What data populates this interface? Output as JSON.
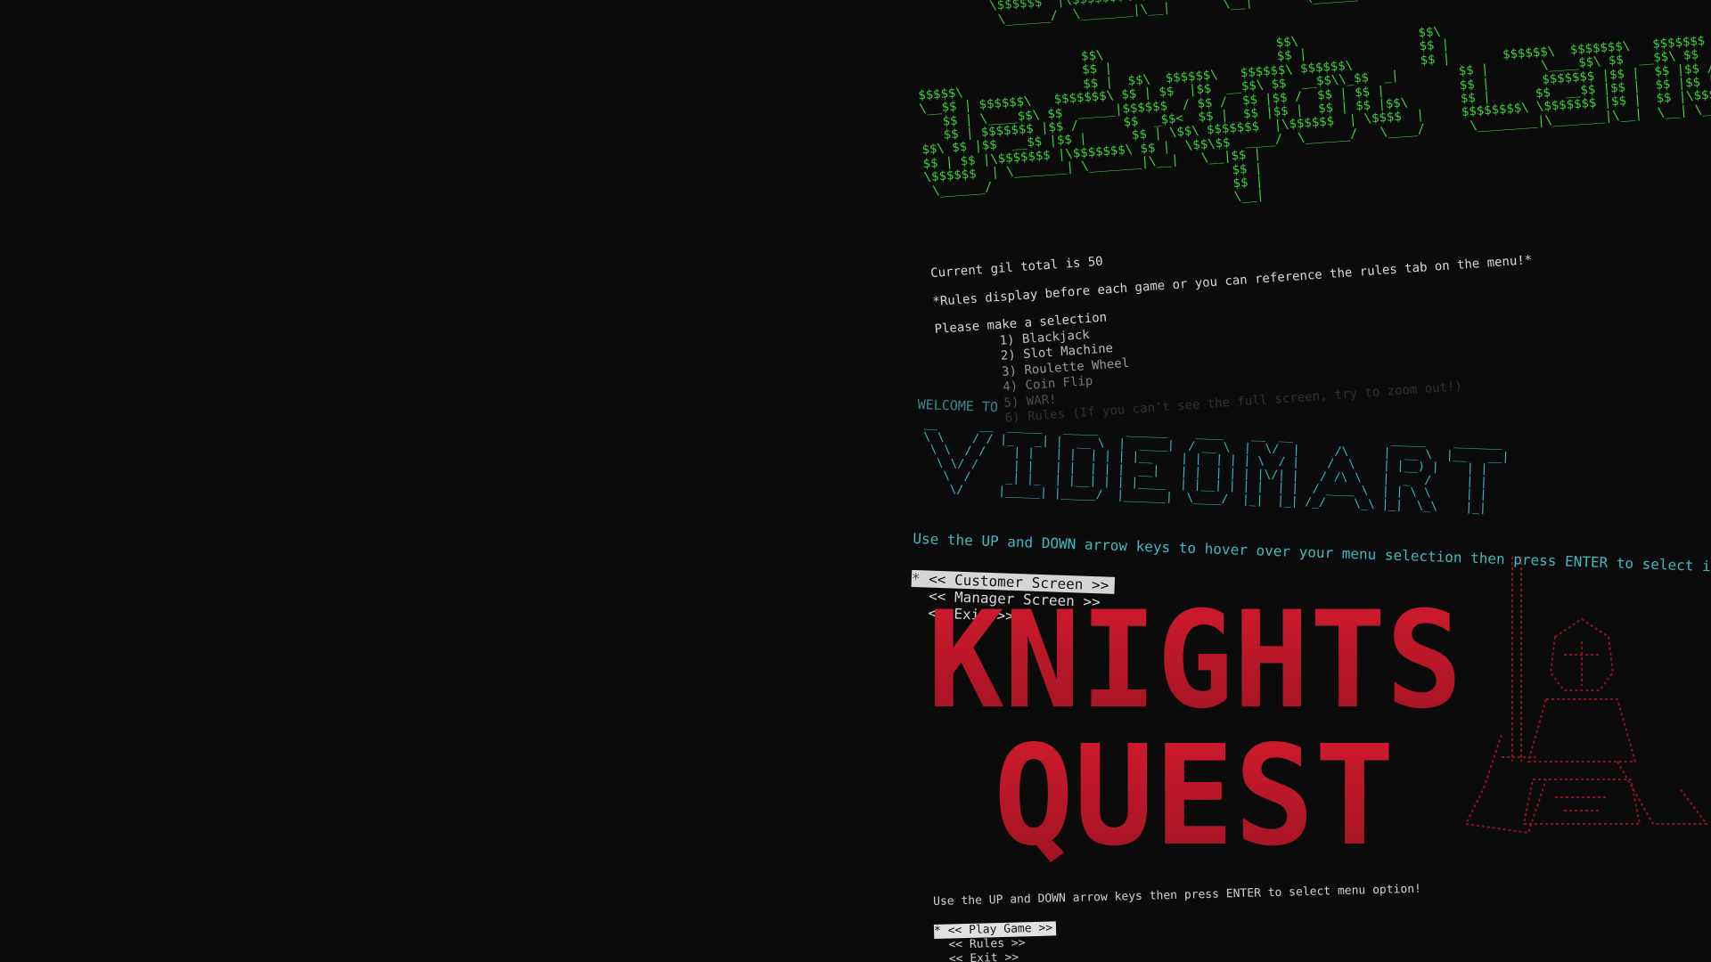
{
  "jackpot": {
    "title_ascii_top": "      $$ |$$  __$$\\ $$$$$$  |   $$  _|     $$  ____$\\   $$$$$$  |  $$$$$$  |\n  $$\\   $$ |$$$$$$$$ |$$  _|     $$ |      $$$$$$$ |   \\$$$$$$  |\\$$$$$$  |\n  $$ |  $$ |$$   ____|$$ |       $$ |      $$  __$$<     \\____$$\\ \\____$$\\\n  \\$$$$$$  |\\$$$$$$$\\ $$ |       $$ |      \\$$$$$$  |   $$$$$$  |\\$$$$$$  |\n   \\______/  \\_______|\\__|       \\__|       \\______/    \\______/  \\______/",
    "title_ascii_main": "                      $$\\                       $$\\                $$\\\n                      $$ |                      $$ |               $$ |\n$$$$$\\                $$ |  $$\\  $$$$$$\\   $$$$$$\\ $$$$$$\\         $$ |       $$$$$$\\  $$$$$$$\\   $$$$$$$ |\n\\__$$ | $$$$$$\\   $$$$$$$\\ $$ | $$  |$$  __$$\\ $$  __$$\\\\_$$  _|        $$ |       \\____$$\\ $$  __$$\\ $$  __$$ |\n   $$ | \\____$$\\ $$  _____|$$$$$$  / $$ /  $$ |$$ /  $$ | $$ |          $$ |       $$$$$$$ |$$ |  $$ |$$ /  $$ |\n   $$ | $$$$$$$ |$$ /      $$  _$$<  $$ |  $$ |$$ |  $$ | $$ |$$\\       $$ |      $$  __$$ |$$ |  $$ |$$ |  $$ |\n$$\\ $$ |$$  __$$ |$$ |      $$ | \\$$\\ $$$$$$$  |\\$$$$$$  | \\$$$$  |     $$$$$$$$\\ \\$$$$$$$ |$$ |  $$ |\\$$$$$$$ |\n$$ | $$ |\\$$$$$$$ |\\$$$$$$$\\ $$ |  \\$$\\$$  ____/  \\______/   \\____/      \\________|\\_______|\\__|  \\__| \\_______|\n\\$$$$$$  | \\_______| \\_______|\\__|   \\__|$$ |\n \\______/                                $$ |\n                                         $$ |\n                                         \\__|",
    "gil_line": "Current gil total is 50",
    "rules_note": "*Rules display before each game or you can reference the rules tab on the menu!*",
    "prompt": "Please make a selection",
    "menu": [
      "1) Blackjack",
      "2) Slot Machine",
      "3) Roulette Wheel",
      "4) Coin Flip",
      "5) WAR!",
      "6) Rules (If you can't see the full screen, try to zoom out!)"
    ]
  },
  "videomart": {
    "welcome": "WELCOME TO",
    "logo_ascii": " __      __  _____   _____    ______    ____    __  __              _____    _______\n \\ \\    / / |_   _| |  __ \\  |  ____|  / __ \\  |  \\/  |     /\\     |  __ \\  |__   __|\n  \\ \\  / /    | |   | |  | | | |__    | |  | | | \\  / |    /  \\    | |__) |    | |\n   \\ \\/ /     | |   | |  | | |  __|   | |  | | | |\\/| |   / /\\ \\   |  _  /     | |\n    \\  /     _| |_  | |__| | | |____  | |__| | | |  | |  / ____ \\  | | \\ \\     | |\n     \\/     |_____| |_____/  |______|  \\____/  |_|  |_| /_/    \\_\\ |_|  \\_\\    |_|",
    "help": "Use the UP and DOWN arrow keys to hover over your menu selection then press ENTER to select it!",
    "selected_marker": "*",
    "menu": [
      "<< Customer Screen >>",
      "<< Manager Screen >>",
      "<< Exit >>"
    ]
  },
  "knights": {
    "logo_lines": [
      "KNIGHTS",
      "QUEST"
    ],
    "help": "Use the UP and DOWN arrow keys then press ENTER to select menu option!",
    "selected_marker": "*",
    "menu": [
      "<< Play Game >>",
      "<< Rules >>",
      "<< Exit >>"
    ]
  },
  "colors": {
    "background": "#0b0b0b",
    "jackpot_green": "#3bd13b",
    "videomart_cyan": "#35c7cf",
    "knights_red": "#b5182a"
  }
}
